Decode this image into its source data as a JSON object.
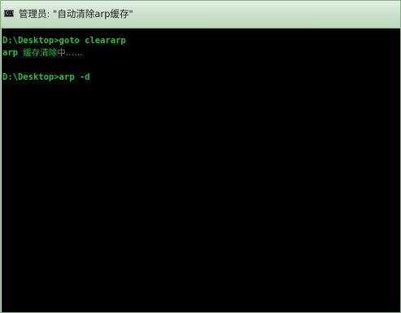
{
  "window": {
    "icon_label": "C:\\",
    "title": "管理员: \"自动清除arp缓存\""
  },
  "console": {
    "colors": {
      "background": "#000000",
      "text": "#1fc43a"
    },
    "lines": [
      {
        "prompt": "D:\\Desktop>",
        "text": "goto cleararp"
      },
      {
        "prompt": "arp ",
        "text": "缓存清除中……"
      },
      {
        "prompt": "D:\\Desktop>",
        "text": "arp -d"
      }
    ]
  }
}
